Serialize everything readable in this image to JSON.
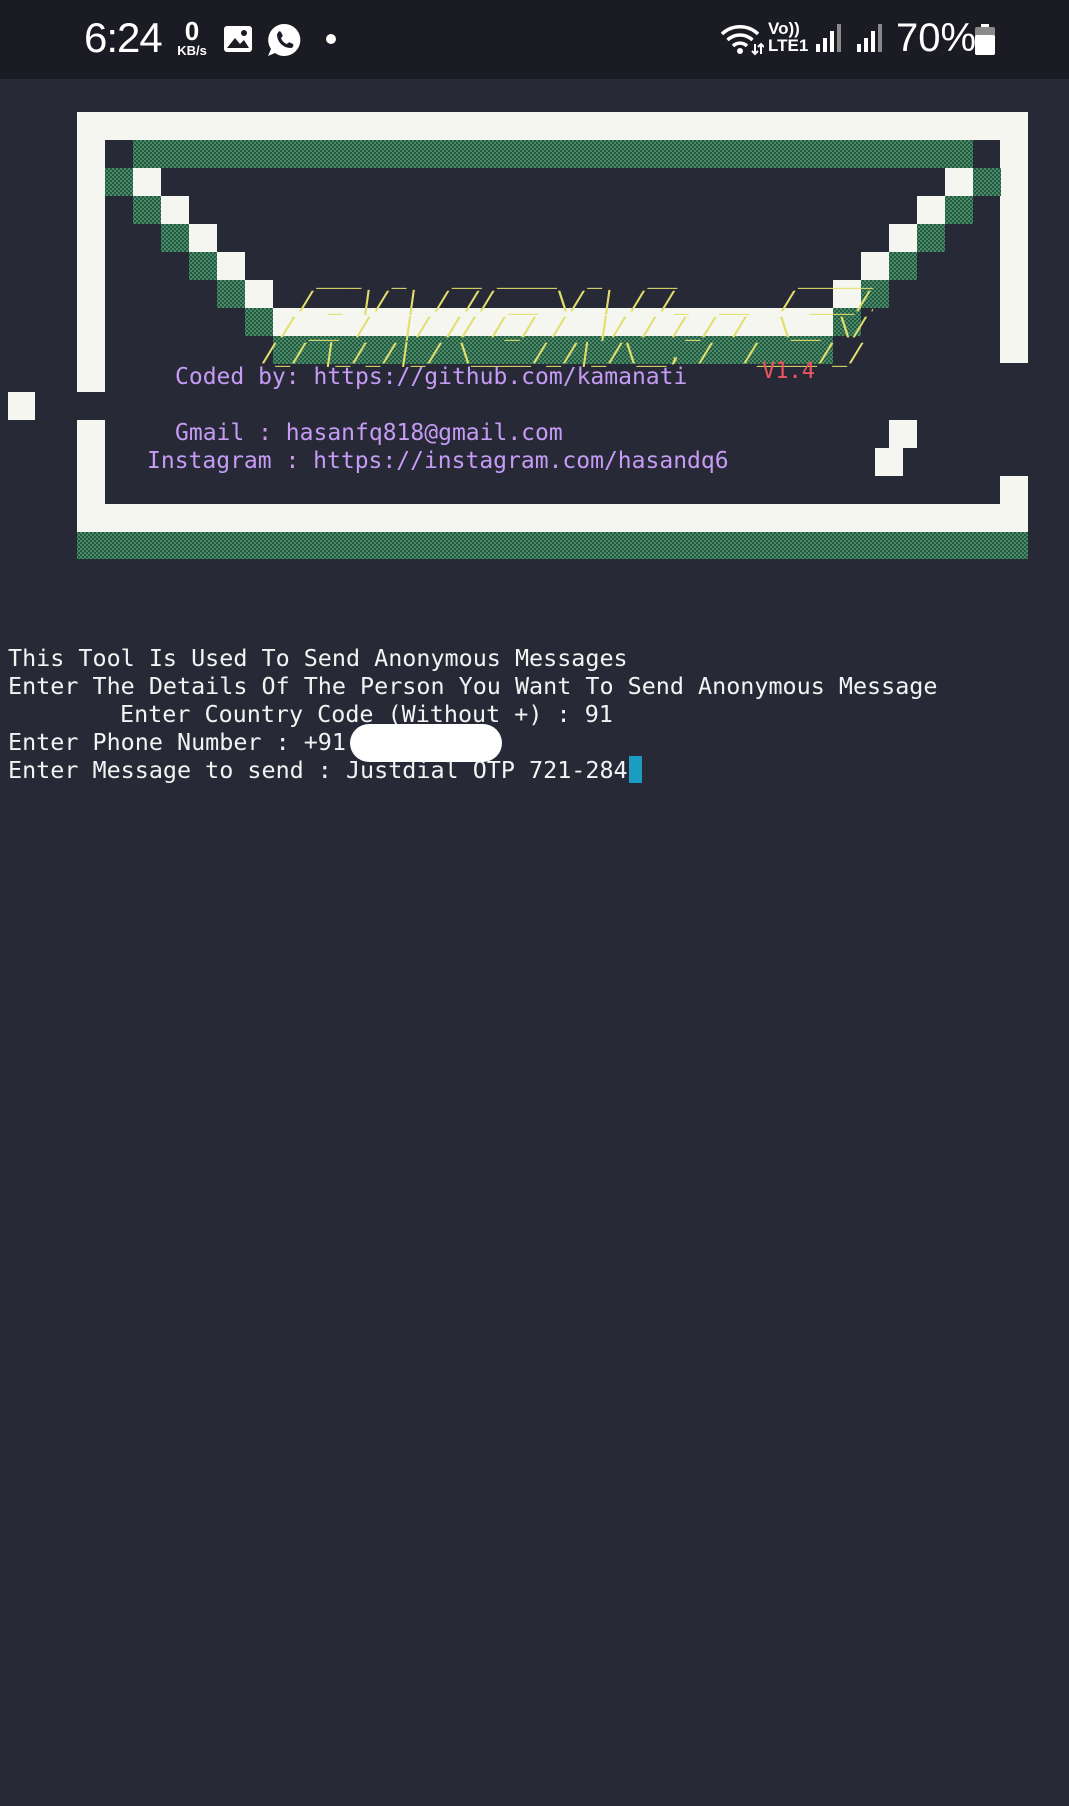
{
  "status_bar": {
    "time": "6:24",
    "net_speed_value": "0",
    "net_speed_unit": "KB/s",
    "volte_top": "Vo))",
    "volte_bottom": "LTE1",
    "battery": "70%",
    "icons": [
      "gallery-icon",
      "whatsapp-icon",
      "notification-dot-icon",
      "wifi-icon",
      "signal-icon",
      "signal-icon",
      "battery-icon"
    ]
  },
  "banner": {
    "logo_lines": [
      "    ___  _   __ ____  _   __        _____ __  ___ _____",
      "   / _ |/ | / // __ \\/ | / /_  __  / ___//  |/  // ___/",
      "  / __ /  |/ // /_/ /  |/ / /_/ /  \\__ \\/ /|_/ / \\__ \\",
      " /_/ |_/_/|_/ \\____/_/|_/\\__, /  /____/_/  /_/ /____/"
    ],
    "version": "V1.4",
    "coded_by": "Coded by: https://github.com/kamanati",
    "gmail": "Gmail : hasanfq818@gmail.com",
    "instagram": "Instagram : https://instagram.com/hasandq6",
    "colors": {
      "frame_white": "#f5f6f0",
      "frame_green": "#2f6a4c",
      "logo": "#e3de6c",
      "version": "#f0555f",
      "credits": "#c69bf5"
    }
  },
  "terminal": {
    "line1": "This Tool Is Used To Send Anonymous Messages",
    "line2": "Enter The Details Of The Person You Want To Send Anonymous Message",
    "line3": "Enter Country Code (Without +) : 91",
    "line4": "Enter Phone Number : +91",
    "line5": "Enter Message to send : Justdial OTP 721-284",
    "background": "#272a36",
    "cursor_color": "#1c9bc3"
  }
}
